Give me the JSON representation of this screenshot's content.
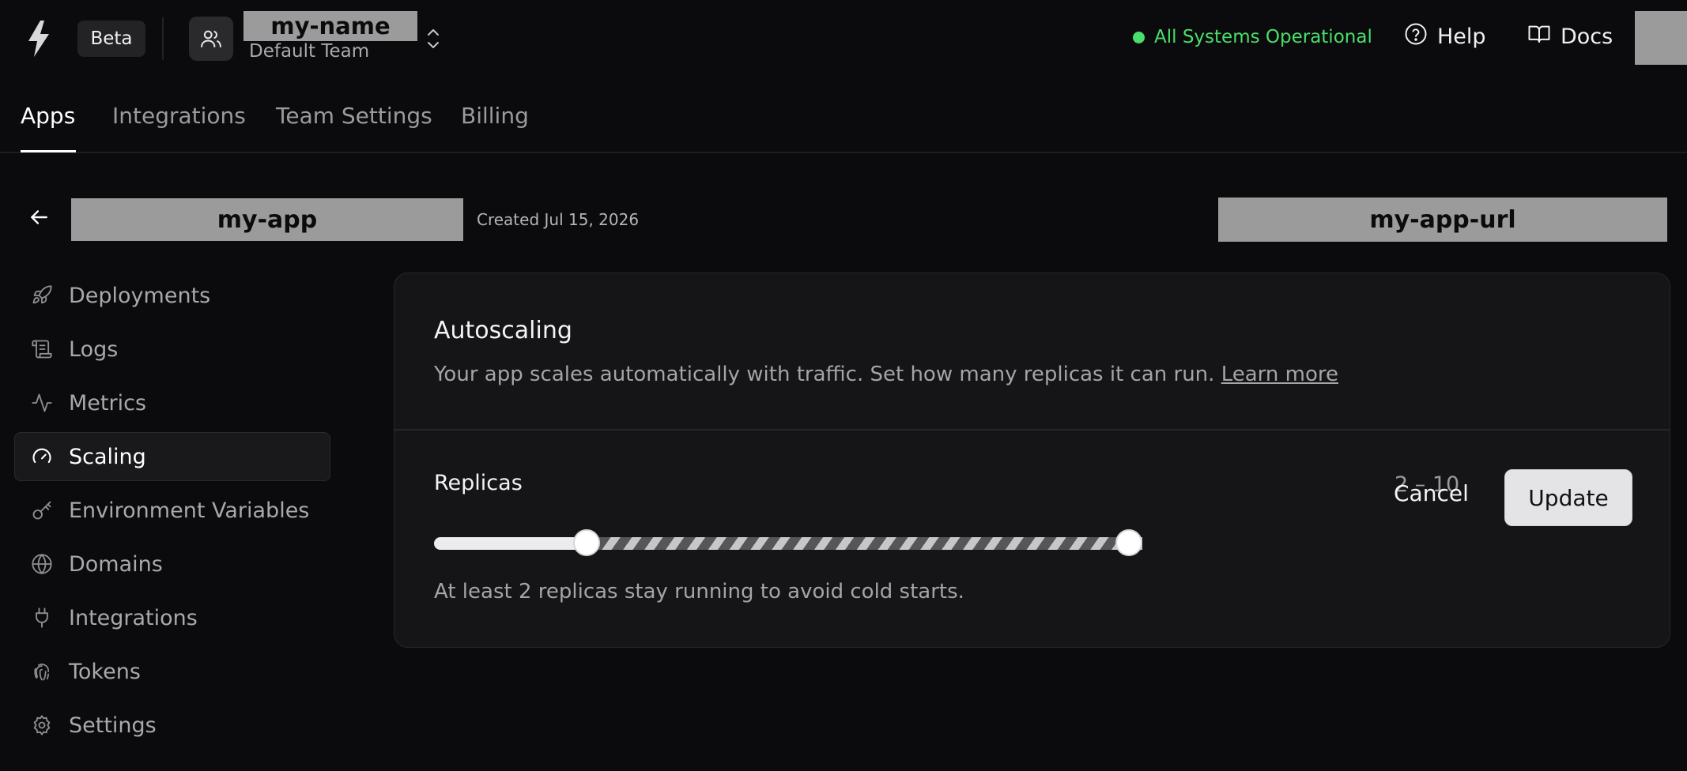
{
  "header": {
    "beta_label": "Beta",
    "team_name": "my-name",
    "team_subtitle": "Default Team",
    "status_text": "All Systems Operational",
    "status_color": "#4ade6a",
    "help_label": "Help",
    "docs_label": "Docs"
  },
  "tabs": [
    {
      "label": "Apps",
      "active": true
    },
    {
      "label": "Integrations",
      "active": false
    },
    {
      "label": "Team Settings",
      "active": false
    },
    {
      "label": "Billing",
      "active": false
    }
  ],
  "app": {
    "name": "my-app",
    "created": "Created Jul 15, 2026",
    "url": "my-app-url"
  },
  "sidebar": {
    "items": [
      {
        "label": "Deployments",
        "icon": "rocket-icon",
        "active": false
      },
      {
        "label": "Logs",
        "icon": "scroll-icon",
        "active": false
      },
      {
        "label": "Metrics",
        "icon": "activity-icon",
        "active": false
      },
      {
        "label": "Scaling",
        "icon": "gauge-icon",
        "active": true
      },
      {
        "label": "Environment Variables",
        "icon": "key-icon",
        "active": false
      },
      {
        "label": "Domains",
        "icon": "globe-icon",
        "active": false
      },
      {
        "label": "Integrations",
        "icon": "plug-icon",
        "active": false
      },
      {
        "label": "Tokens",
        "icon": "fingerprint-icon",
        "active": false
      },
      {
        "label": "Settings",
        "icon": "gear-icon",
        "active": false
      }
    ]
  },
  "scaling": {
    "title": "Autoscaling",
    "description": "Your app scales automatically with traffic. Set how many replicas it can run.",
    "learn_more": "Learn more",
    "replicas_label": "Replicas",
    "replicas_value": "2 – 10",
    "slider": {
      "min_value": 2,
      "max_value": 10,
      "low_fraction": 0.215,
      "high_fraction": 1.0
    },
    "hint": "At least 2 replicas stay running to avoid cold starts.",
    "cancel_label": "Cancel",
    "update_label": "Update"
  }
}
